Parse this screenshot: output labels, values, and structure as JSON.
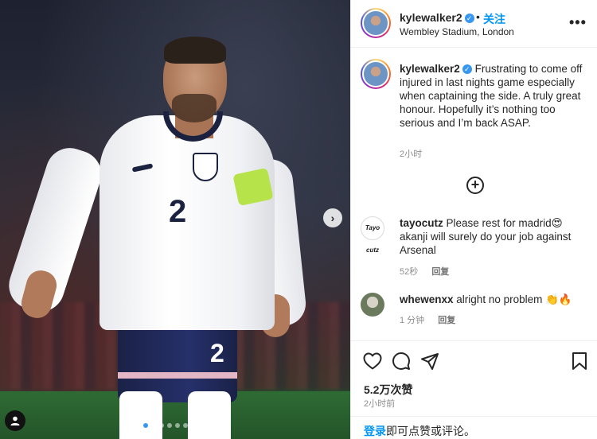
{
  "post": {
    "username": "kylewalker2",
    "follow_label": "关注",
    "dot": "•",
    "location": "Wembley Stadium, London",
    "more_label": "•••",
    "next_arrow": "›",
    "load_more_label": "+",
    "image_dots": 9,
    "active_dot": 0
  },
  "caption": {
    "username": "kylewalker2",
    "text": "Frustrating to come off injured in last nights game especially when captaining the side. A truly great honour. Hopefully it’s nothing too serious and I’m back ASAP.",
    "time": "2小时"
  },
  "comments": [
    {
      "username": "tayocutz",
      "avatar_text": "Tayo cutz",
      "text": "Please rest for madrid😍 akanji will surely do your job against Arsenal",
      "time": "52秒",
      "reply_label": "回复"
    },
    {
      "username": "whewenxx",
      "text": "alright no problem 👏🔥",
      "time": "1 分钟",
      "reply_label": "回复"
    }
  ],
  "actions": {
    "likes": "5.2万次赞",
    "posted": "2小时前"
  },
  "login_bar": {
    "login_label": "登录",
    "rest": "即可点赞或评论。"
  },
  "jersey": {
    "shirt_number": "2",
    "shorts_number": "2"
  },
  "colors": {
    "link_blue": "#0095f6",
    "verified_blue": "#3897f0",
    "secondary_text": "#8e8e8e"
  },
  "icons": {
    "like": "heart-icon",
    "comment": "comment-icon",
    "share": "share-icon",
    "save": "bookmark-icon"
  }
}
